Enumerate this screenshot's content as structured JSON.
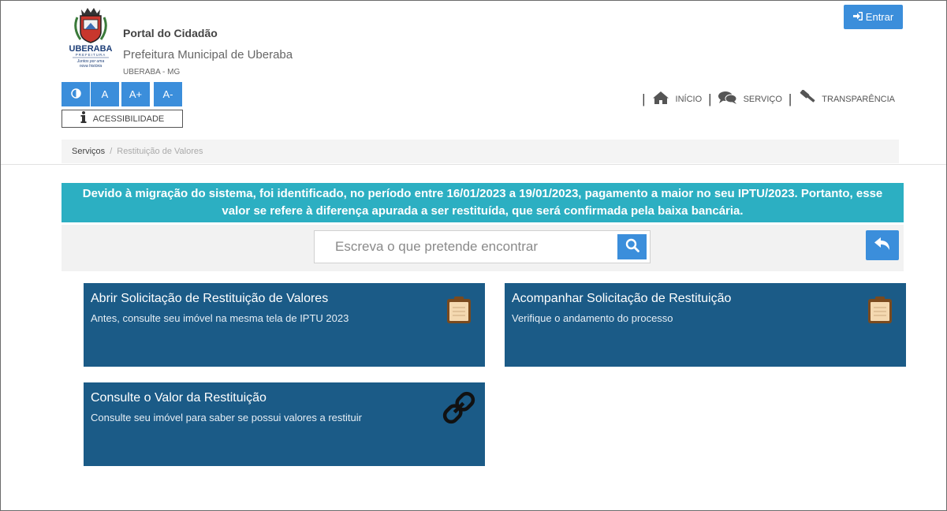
{
  "header": {
    "logo_text": "UBERABA",
    "logo_sub": "PREFEITURA",
    "logo_tagline": "Juntos por uma nova história",
    "portal_title": "Portal do Cidadão",
    "org_name": "Prefeitura Municipal de Uberaba",
    "location": "UBERABA - MG",
    "login_label": "Entrar"
  },
  "accessibility": {
    "buttons": [
      {
        "label": "◐",
        "icon": "contrast-icon"
      },
      {
        "label": "A"
      },
      {
        "label": "A+"
      },
      {
        "label": "A-"
      }
    ],
    "label": "ACESSIBILIDADE",
    "label_icon": "info-icon"
  },
  "nav": {
    "items": [
      {
        "label": "INÍCIO",
        "icon": "home-icon"
      },
      {
        "label": "SERVIÇO",
        "icon": "comments-icon"
      },
      {
        "label": "TRANSPARÊNCIA",
        "icon": "gavel-icon"
      }
    ]
  },
  "breadcrumb": {
    "link": "Serviços",
    "separator": "/",
    "current": "Restituição de Valores"
  },
  "notice": {
    "text": "Devido à migração do sistema, foi identificado, no período entre 16/01/2023 a 19/01/2023, pagamento a maior no seu IPTU/2023. Portanto, esse valor se refere à diferença apurada a ser restituída, que será confirmada pela baixa bancária."
  },
  "search": {
    "placeholder": "Escreva o que pretende encontrar",
    "value": ""
  },
  "cards": [
    {
      "title": "Abrir Solicitação de Restituição de Valores",
      "description": "Antes, consulte seu imóvel na mesma tela de IPTU 2023",
      "icon": "clipboard-icon"
    },
    {
      "title": "Acompanhar Solicitação de Restituição",
      "description": "Verifique o andamento do processo",
      "icon": "clipboard-icon"
    },
    {
      "title": "Consulte o Valor da Restituição",
      "description": "Consulte seu imóvel para saber se possui valores a restituir",
      "icon": "link-icon"
    }
  ],
  "colors": {
    "primary_button": "#3b8edb",
    "notice_bg": "#2cafc2",
    "card_bg": "#1b5b87",
    "clipboard": "#f4d9b1"
  }
}
